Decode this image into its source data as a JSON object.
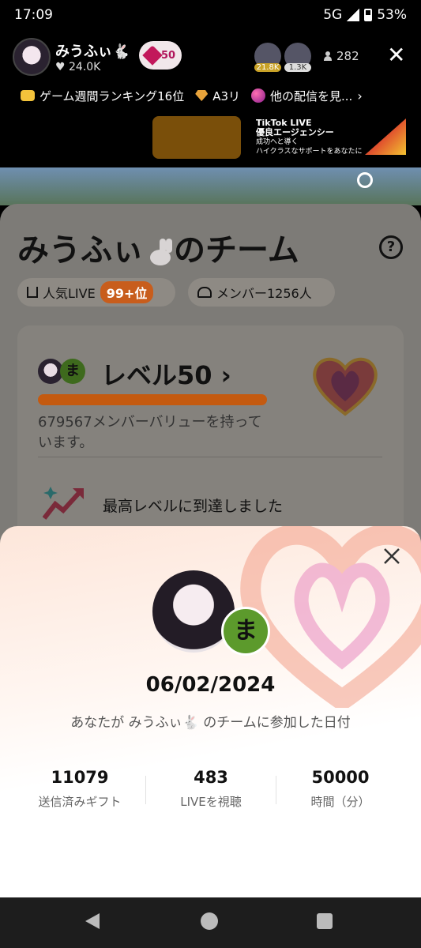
{
  "status_bar": {
    "time": "17:09",
    "network": "5G",
    "battery": "53%"
  },
  "live": {
    "host_name": "みうふぃ🐇",
    "host_likes": "♥ 24.0K",
    "level_badge": "50",
    "viewer1_badge": "21.8K",
    "viewer2_badge": "1.3K",
    "viewer_count": "282"
  },
  "banner": {
    "item1": "ゲーム週間ランキング16位",
    "item2": "A3リ",
    "item3": "他の配信を見..."
  },
  "ad": {
    "line1": "TikTok LIVE",
    "line2": "優良エージェンシー",
    "line3": "成功へと導く",
    "line4": "ハイクラスなサポートをあなたに"
  },
  "team": {
    "name": "みうふぃ",
    "suffix": "のチーム",
    "popular_label": "人気LIVE",
    "rank": "99+位",
    "members": "メンバー1256人",
    "level": "レベル50 ›",
    "avatar2_char": "ま",
    "member_value": "679567メンバーバリューを持っています。",
    "max_level": "最高レベルに到達しました"
  },
  "modal": {
    "avatar2_char": "ま",
    "join_date": "06/02/2024",
    "caption": "あなたが みうふぃ🐇 のチームに参加した日付",
    "stats": [
      {
        "value": "11079",
        "label": "送信済みギフト"
      },
      {
        "value": "483",
        "label": "LIVEを視聴"
      },
      {
        "value": "50000",
        "label": "時間（分）"
      }
    ]
  },
  "colors": {
    "accent": "#c85d1c",
    "heart": "#c2185b"
  }
}
